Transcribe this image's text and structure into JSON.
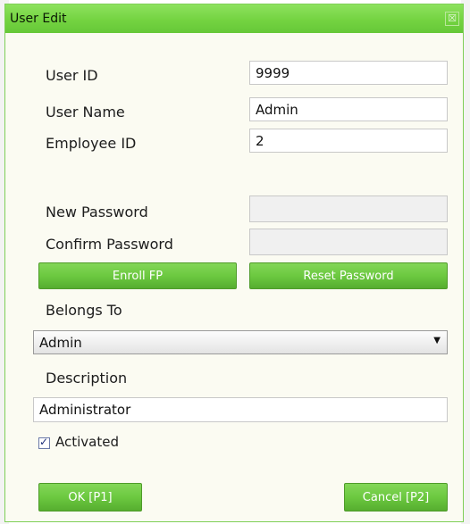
{
  "window": {
    "title": "User Edit",
    "close_glyph": "☒"
  },
  "form": {
    "user_id": {
      "label": "User ID",
      "value": "9999"
    },
    "user_name": {
      "label": "User Name",
      "value": "Admin"
    },
    "employee_id": {
      "label": "Employee ID",
      "value": "2"
    },
    "new_password": {
      "label": "New Password",
      "value": ""
    },
    "confirm_password": {
      "label": "Confirm Password",
      "value": ""
    },
    "enroll_fp_label": "Enroll FP",
    "reset_password_label": "Reset Password",
    "belongs_to": {
      "label": "Belongs To",
      "selected": "Admin"
    },
    "description": {
      "label": "Description",
      "value": "Administrator"
    },
    "activated": {
      "label": "Activated",
      "checked": true
    }
  },
  "footer": {
    "ok_label": "OK [P1]",
    "cancel_label": "Cancel [P2]"
  },
  "colors": {
    "accent_green": "#6cc940",
    "title_green": "#74d341",
    "dialog_bg": "#fbfbf2"
  }
}
